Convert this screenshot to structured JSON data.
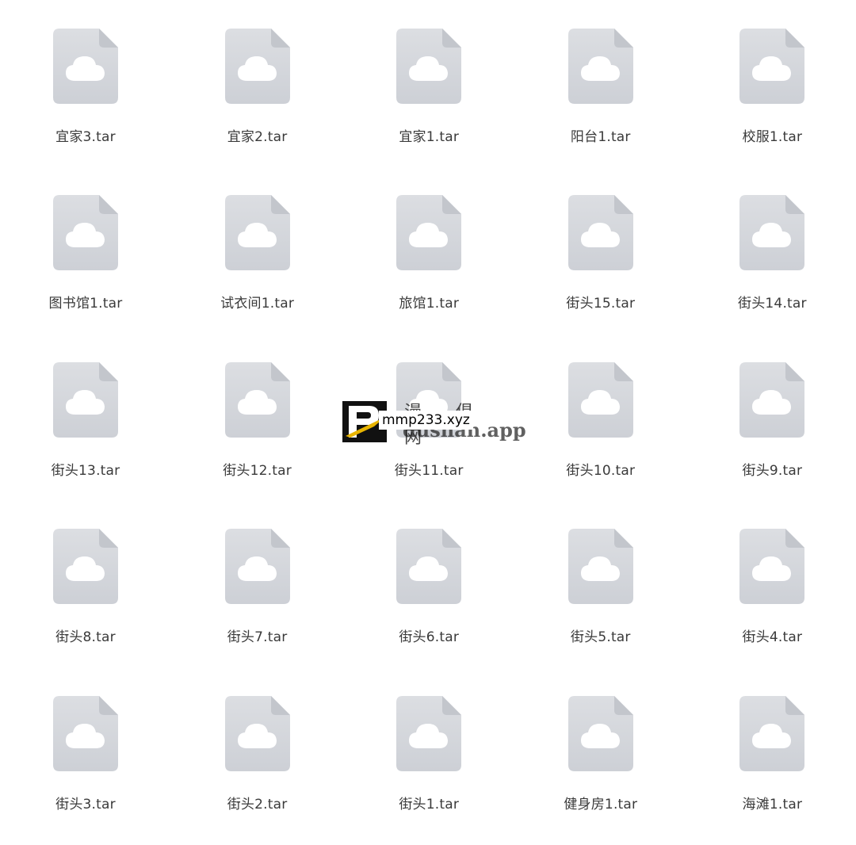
{
  "files": [
    {
      "name": "宜家3.tar"
    },
    {
      "name": "宜家2.tar"
    },
    {
      "name": "宜家1.tar"
    },
    {
      "name": "阳台1.tar"
    },
    {
      "name": "校服1.tar"
    },
    {
      "name": "图书馆1.tar"
    },
    {
      "name": "试衣间1.tar"
    },
    {
      "name": "旅馆1.tar"
    },
    {
      "name": "街头15.tar"
    },
    {
      "name": "街头14.tar"
    },
    {
      "name": "街头13.tar"
    },
    {
      "name": "街头12.tar"
    },
    {
      "name": "街头11.tar"
    },
    {
      "name": "街头10.tar"
    },
    {
      "name": "街头9.tar"
    },
    {
      "name": "街头8.tar"
    },
    {
      "name": "街头7.tar"
    },
    {
      "name": "街头6.tar"
    },
    {
      "name": "街头5.tar"
    },
    {
      "name": "街头4.tar"
    },
    {
      "name": "街头3.tar"
    },
    {
      "name": "街头2.tar"
    },
    {
      "name": "街头1.tar"
    },
    {
      "name": "健身房1.tar"
    },
    {
      "name": "海滩1.tar"
    }
  ],
  "icon": {
    "name": "cloud-file-icon",
    "page_color": "#d5d7dc",
    "cloud_color": "#ffffff"
  },
  "watermark": {
    "label": "mmp233.xyz",
    "chinese_text": "漫 俱 网",
    "url_text": "dushan.app",
    "logo_letter": "P"
  }
}
